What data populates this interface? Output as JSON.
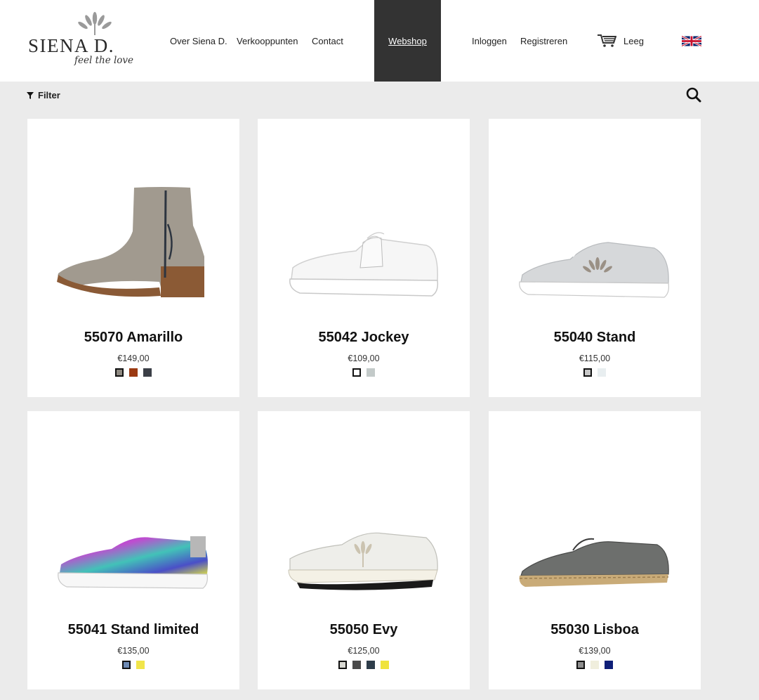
{
  "logo": {
    "brand": "SIENA D.",
    "tagline": "feel the love"
  },
  "nav": {
    "about": "Over Siena D.",
    "stores": "Verkooppunten",
    "contact": "Contact",
    "webshop": "Webshop",
    "login": "Inloggen",
    "register": "Registreren",
    "cart_status": "Leeg"
  },
  "toolbar": {
    "filter_label": "Filter"
  },
  "products": [
    {
      "name": "55070 Amarillo",
      "price": "€149,00",
      "image": "ankle-boot",
      "colors": [
        "#8f8a82",
        "#9b3a12",
        "#3b3f47"
      ]
    },
    {
      "name": "55042 Jockey",
      "price": "€109,00",
      "image": "white-kiltie-sneaker",
      "colors": [
        "#ffffff",
        "#c3cac9"
      ]
    },
    {
      "name": "55040 Stand",
      "price": "€115,00",
      "image": "silver-sneaker",
      "colors": [
        "#c8c8c8",
        "#e8eef0"
      ]
    },
    {
      "name": "55041 Stand limited",
      "price": "€135,00",
      "image": "multicolor-sneaker",
      "colors": [
        "#6d8ab4",
        "#f1e54a"
      ]
    },
    {
      "name": "55050 Evy",
      "price": "€125,00",
      "image": "white-runner",
      "colors": [
        "#d8d8d2",
        "#4a4a4a",
        "#2e3d4a",
        "#f0e33c"
      ]
    },
    {
      "name": "55030 Lisboa",
      "price": "€139,00",
      "image": "grey-espadrille-brogue",
      "colors": [
        "#8e8e8e",
        "#f0eedd",
        "#0f1f78"
      ]
    }
  ]
}
